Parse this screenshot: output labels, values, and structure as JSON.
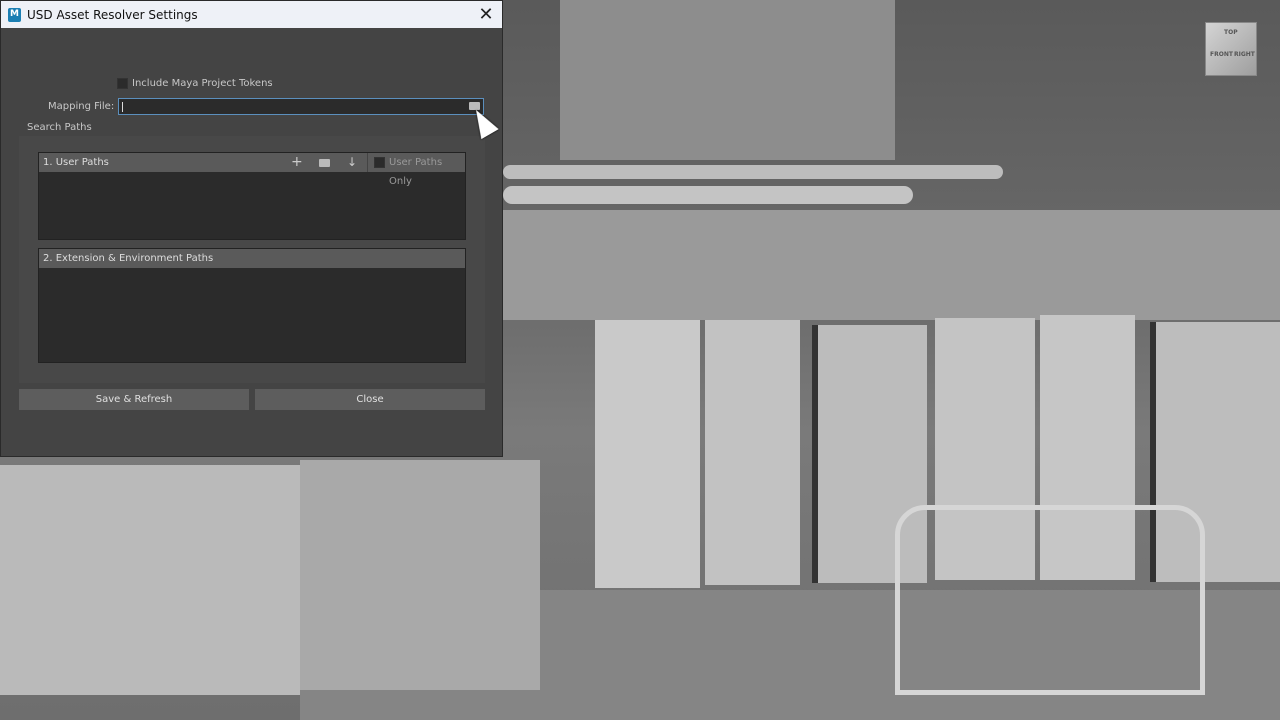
{
  "dialog": {
    "title": "USD Asset Resolver Settings",
    "app_icon_letter": "M",
    "include_tokens_label": "Include Maya Project Tokens",
    "include_tokens_checked": false,
    "mapping_file_label": "Mapping File:",
    "mapping_file_value": "",
    "search_paths_label": "Search Paths",
    "user_paths": {
      "title": "1. User Paths",
      "add_icon": "+",
      "down_icon": "↓",
      "user_paths_only_label": "User Paths Only",
      "user_paths_only_checked": false
    },
    "ext_paths": {
      "title": "2. Extension & Environment Paths"
    },
    "save_label": "Save & Refresh",
    "close_label": "Close"
  },
  "viewport": {
    "viewcube_labels": [
      "TOP",
      "FRONT",
      "RIGHT"
    ]
  }
}
